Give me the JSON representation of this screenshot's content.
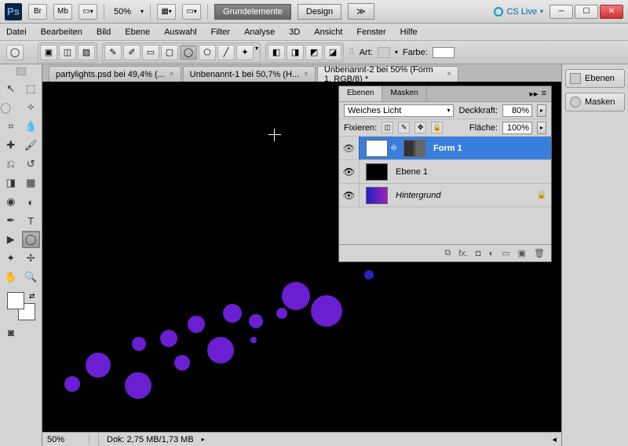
{
  "titlebar": {
    "zoom": "50%",
    "workspace_active": "Grundelemente",
    "workspace_next": "Design",
    "cslive": "CS Live"
  },
  "menu": {
    "datei": "Datei",
    "bearbeiten": "Bearbeiten",
    "bild": "Bild",
    "ebene": "Ebene",
    "auswahl": "Auswahl",
    "filter": "Filter",
    "analyse": "Analyse",
    "dd": "3D",
    "ansicht": "Ansicht",
    "fenster": "Fenster",
    "hilfe": "Hilfe"
  },
  "options": {
    "art": "Art:",
    "farbe": "Farbe:"
  },
  "tabs": {
    "t0": "partylights.psd bei 49,4% (...",
    "t1": "Unbenannt-1 bei 50,7% (H...",
    "t2": "Unbenannt-2 bei 50% (Form 1, RGB/8) *"
  },
  "status": {
    "zoom": "50%",
    "doc": "Dok: 2,75 MB/1,73 MB"
  },
  "panels": {
    "ebenen": "Ebenen",
    "masken": "Masken",
    "blend": "Weiches Licht",
    "deckkraft_lbl": "Deckkraft:",
    "deckkraft_val": "80%",
    "fixieren": "Fixieren:",
    "flaeche_lbl": "Fläche:",
    "flaeche_val": "100%",
    "layer0": "Form 1",
    "layer1": "Ebene 1",
    "layer2": "Hintergrund"
  },
  "right": {
    "ebenen": "Ebenen",
    "masken": "Masken"
  }
}
